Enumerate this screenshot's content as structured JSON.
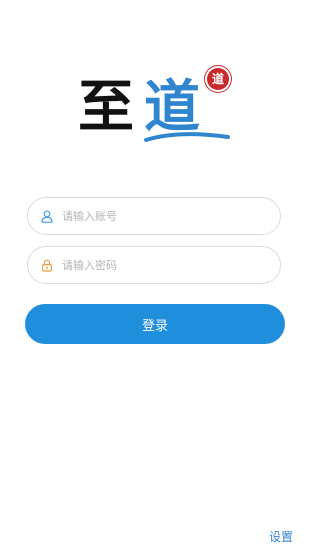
{
  "logo": {
    "char_1": "至",
    "char_2": "道",
    "seal_text": "道"
  },
  "login_form": {
    "account": {
      "placeholder": "请输入账号",
      "value": ""
    },
    "password": {
      "placeholder": "请输入密码",
      "value": ""
    },
    "submit_label": "登录"
  },
  "footer": {
    "settings_label": "设置"
  },
  "icons": {
    "account": "user-icon",
    "password": "lock-icon"
  },
  "colors": {
    "brand_blue": "#1f8fdc",
    "logo_blue": "#2f86cf",
    "seal_red": "#c9282d",
    "field_border": "#dcdcdc",
    "placeholder": "#b5b5b5"
  }
}
